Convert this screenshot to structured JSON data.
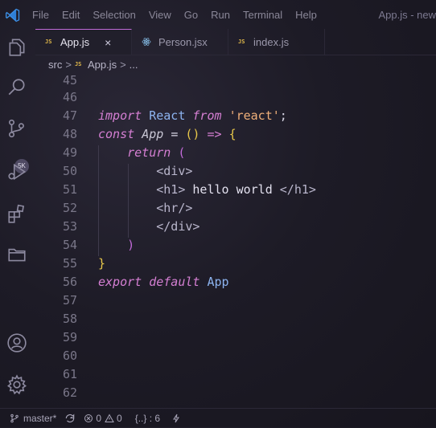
{
  "menu": [
    "File",
    "Edit",
    "Selection",
    "View",
    "Go",
    "Run",
    "Terminal",
    "Help"
  ],
  "window_title": "App.js - new",
  "activity": {
    "icons": [
      "explorer-icon",
      "search-icon",
      "source-control-icon",
      "run-debug-icon",
      "extensions-icon",
      "folder-icon",
      "account-icon",
      "settings-gear-icon"
    ],
    "scm_badge": "5K"
  },
  "tabs": [
    {
      "label": "App.js",
      "icon": "js",
      "active": true,
      "close": "×"
    },
    {
      "label": "Person.jsx",
      "icon": "react"
    },
    {
      "label": "index.js",
      "icon": "js"
    }
  ],
  "icon_text": {
    "js": "JS"
  },
  "breadcrumb": {
    "folder": "src",
    "file": "App.js",
    "sep": ">",
    "more": "..."
  },
  "editor": {
    "line_numbers": [
      "45",
      "46",
      "47",
      "48",
      "49",
      "50",
      "51",
      "52",
      "53",
      "54",
      "55",
      "56",
      "57",
      "58",
      "59",
      "60",
      "61",
      "62"
    ]
  },
  "status": {
    "branch": "master*",
    "errors": "0",
    "warnings": "0",
    "selection": "{..} : 6"
  },
  "colors": {
    "accent": "#c16ad8",
    "keyword": "#d57fd3",
    "identifier": "#8db4f0",
    "string": "#f0b07a",
    "brace": "#e8c84a"
  }
}
